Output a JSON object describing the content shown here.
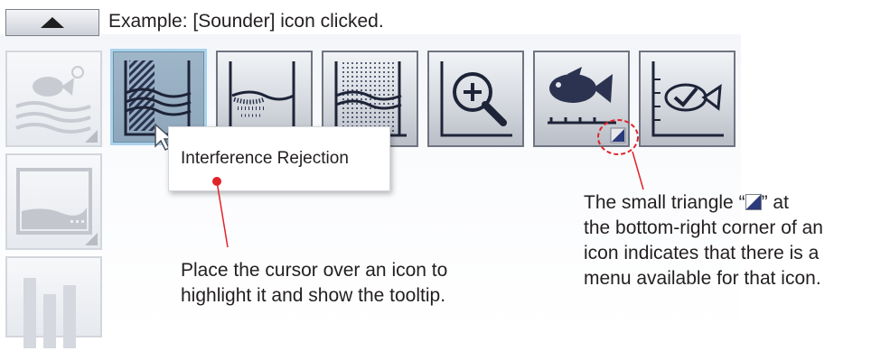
{
  "header": {
    "collapse_button_icon": "triangle-up-icon",
    "caption": "Example: [Sounder] icon clicked."
  },
  "toolbar": {
    "icons": [
      {
        "name": "interference-rejection-icon",
        "highlighted": true
      },
      {
        "name": "sounder-bottom-echo-icon"
      },
      {
        "name": "sounder-noise-echo-icon"
      },
      {
        "name": "zoom-icon"
      },
      {
        "name": "fish-scale-icon",
        "has_menu": true
      },
      {
        "name": "fish-check-icon"
      }
    ]
  },
  "side_panel": {
    "icons": [
      "fish-finder-icon",
      "display-screen-icon",
      "bar-graph-icon"
    ]
  },
  "tooltip": {
    "text": "Interference Rejection"
  },
  "callouts": {
    "cursor_lines": [
      "Place the cursor over an icon to",
      "highlight it and show the tooltip."
    ],
    "triangle_line1_before": "The small triangle “",
    "triangle_line1_after": "”  at",
    "triangle_lines": [
      "the bottom-right corner of an",
      "icon indicates that there is a",
      "menu available for that icon."
    ]
  },
  "colors": {
    "highlight_border": "#a9d2ec",
    "pointer_red": "#e2232a",
    "icon_dark": "#2b3350"
  }
}
